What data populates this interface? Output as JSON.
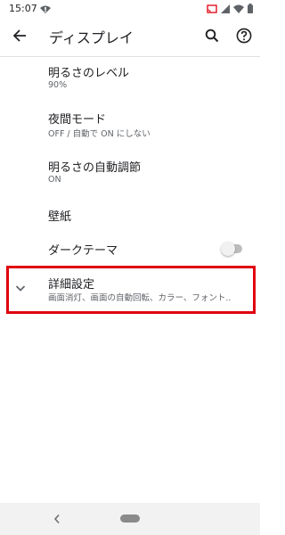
{
  "status_bar": {
    "time": "15:07",
    "left_icon": "wifi-warning-icon",
    "right_icons": [
      "cast-icon",
      "signal-icon",
      "wifi-icon",
      "battery-icon"
    ]
  },
  "app_bar": {
    "title": "ディスプレイ",
    "back_icon": "arrow-left-icon",
    "search_icon": "search-icon",
    "help_icon": "help-icon"
  },
  "settings": {
    "brightness": {
      "title": "明るさのレベル",
      "summary": "90%"
    },
    "night_mode": {
      "title": "夜間モード",
      "summary": "OFF / 自動で ON にしない"
    },
    "auto_brightness": {
      "title": "明るさの自動調節",
      "summary": "ON"
    },
    "wallpaper": {
      "title": "壁紙"
    },
    "dark_theme": {
      "title": "ダークテーマ",
      "toggle_on": false
    },
    "advanced": {
      "title": "詳細設定",
      "summary": "画面消灯、画面の自動回転、カラー、フォント.."
    }
  },
  "colors": {
    "highlight": "#e0000f",
    "text_primary": "#202124",
    "text_secondary": "#5f6368"
  },
  "nav_bar": {
    "back_icon": "nav-back-icon",
    "home_icon": "nav-home-pill-icon"
  }
}
